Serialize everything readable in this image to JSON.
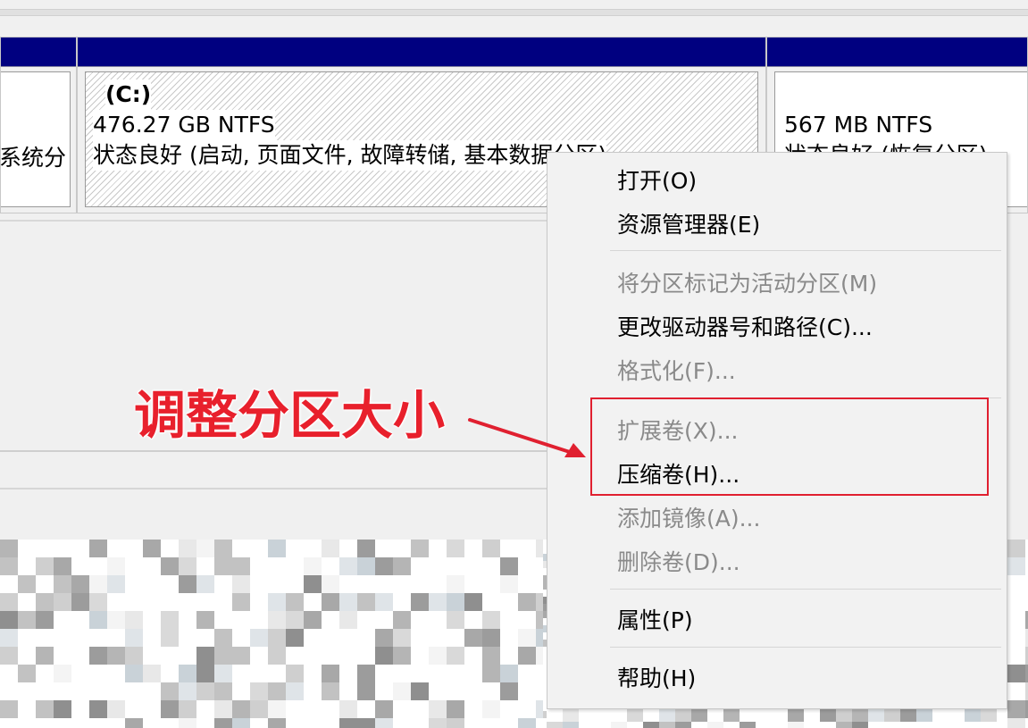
{
  "partitions": [
    {
      "label": "",
      "size": "",
      "status": "系统分"
    },
    {
      "label": "(C:)",
      "size": "476.27 GB NTFS",
      "status": "状态良好 (启动, 页面文件, 故障转储, 基本数据分区)"
    },
    {
      "label": "",
      "size": "567 MB NTFS",
      "status": "状态良好 (恢复分区)"
    }
  ],
  "context_menu": {
    "items": [
      {
        "label": "打开(O)",
        "enabled": true
      },
      {
        "label": "资源管理器(E)",
        "enabled": true
      },
      {
        "label": "将分区标记为活动分区(M)",
        "enabled": false
      },
      {
        "label": "更改驱动器号和路径(C)...",
        "enabled": true
      },
      {
        "label": "格式化(F)...",
        "enabled": false
      },
      {
        "label": "扩展卷(X)...",
        "enabled": false
      },
      {
        "label": "压缩卷(H)...",
        "enabled": true
      },
      {
        "label": "添加镜像(A)...",
        "enabled": false
      },
      {
        "label": "删除卷(D)...",
        "enabled": false
      },
      {
        "label": "属性(P)",
        "enabled": true
      },
      {
        "label": "帮助(H)",
        "enabled": true
      }
    ]
  },
  "annotation": {
    "text": "调整分区大小",
    "color": "#e8202c"
  },
  "colors": {
    "header": "#000080",
    "menu_bg": "#f2f2f2",
    "disabled_text": "#8a8a8a"
  }
}
